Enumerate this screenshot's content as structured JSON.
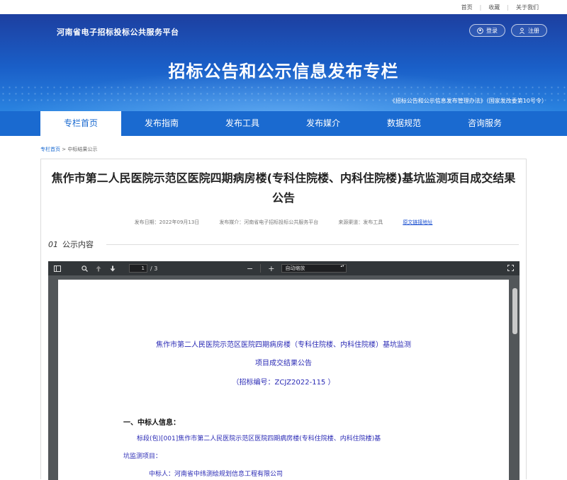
{
  "topbar": {
    "links": [
      "首页",
      "收藏",
      "关于我们"
    ]
  },
  "banner": {
    "brand": "河南省电子招标投标公共服务平台",
    "login": "登录",
    "register": "注册",
    "title": "招标公告和公示信息发布专栏",
    "reg_note": "《招标公告和公示信息发布管理办法》（国家发改委第10号令）"
  },
  "nav": {
    "items": [
      "专栏首页",
      "发布指南",
      "发布工具",
      "发布媒介",
      "数据规范",
      "咨询服务"
    ]
  },
  "breadcrumb": {
    "home": "专栏首页",
    "sep": ">",
    "current": "中标结果公示"
  },
  "article": {
    "title": "焦作市第二人民医院示范区医院四期病房楼(专科住院楼、内科住院楼)基坑监测项目成交结果公告",
    "publish_date": "发布日期：2022年09月13日",
    "publish_media": "发布媒介：河南省电子招标投标公共服务平台",
    "source": "来源渠道：发布工具",
    "original_link": "原文链接地址",
    "section_num": "01",
    "section_label": "公示内容"
  },
  "viewer": {
    "page_current": "1",
    "page_total": "/ 3",
    "zoom_minus": "−",
    "zoom_plus": "+",
    "zoom_mode": "自动缩放"
  },
  "document": {
    "title_line1": "焦作市第二人民医院示范区医院四期病房楼（专科住院楼、内科住院楼）基坑监测",
    "title_line2": "项目成交结果公告",
    "code": "（招标编号：ZCJZ2022-115 ）",
    "section1": "一、中标人信息：",
    "line1": "标段(包)[001]焦作市第二人民医院示范区医院四期病房楼(专科住院楼、内科住院楼)基",
    "line2": "坑监测项目：",
    "line3": "中标人：河南省中纬测绘规划信息工程有限公司"
  }
}
